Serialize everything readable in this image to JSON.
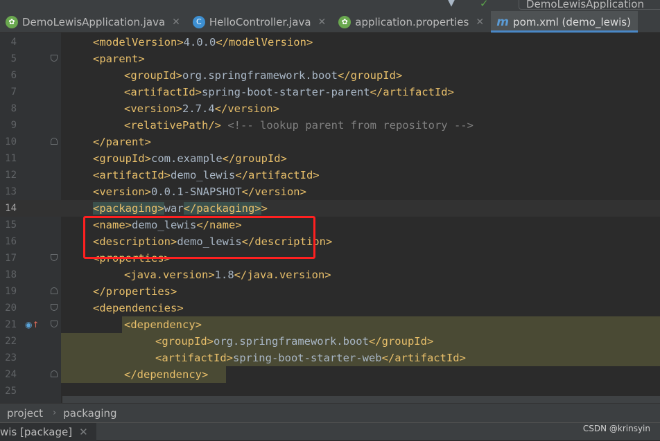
{
  "top": {
    "run_config_label": "DemoLewisApplication"
  },
  "tabs": [
    {
      "label": "DemoLewisApplication.java",
      "icon": "spring-icon",
      "active": false
    },
    {
      "label": "HelloController.java",
      "icon": "class-icon",
      "active": false
    },
    {
      "label": "application.properties",
      "icon": "spring-icon",
      "active": false
    },
    {
      "label": "pom.xml (demo_lewis)",
      "icon": "maven-icon",
      "active": true
    }
  ],
  "editor": {
    "lines": [
      {
        "n": "4",
        "indent": 1,
        "parts": [
          [
            "tag",
            "<modelVersion>"
          ],
          [
            "txt",
            "4.0.0"
          ],
          [
            "tag",
            "</modelVersion>"
          ]
        ]
      },
      {
        "n": "5",
        "indent": 1,
        "fold": "open",
        "parts": [
          [
            "tag",
            "<parent>"
          ]
        ]
      },
      {
        "n": "6",
        "indent": 2,
        "parts": [
          [
            "tag",
            "<groupId>"
          ],
          [
            "txt",
            "org.springframework.boot"
          ],
          [
            "tag",
            "</groupId>"
          ]
        ]
      },
      {
        "n": "7",
        "indent": 2,
        "parts": [
          [
            "tag",
            "<artifactId>"
          ],
          [
            "txt",
            "spring-boot-starter-parent"
          ],
          [
            "tag",
            "</artifactId>"
          ]
        ]
      },
      {
        "n": "8",
        "indent": 2,
        "parts": [
          [
            "tag",
            "<version>"
          ],
          [
            "txt",
            "2.7.4"
          ],
          [
            "tag",
            "</version>"
          ]
        ]
      },
      {
        "n": "9",
        "indent": 2,
        "parts": [
          [
            "tag",
            "<relativePath/>"
          ],
          [
            "txt",
            " "
          ],
          [
            "cmt",
            "<!-- lookup parent from repository -->"
          ]
        ]
      },
      {
        "n": "10",
        "indent": 1,
        "fold": "close",
        "parts": [
          [
            "tag",
            "</parent>"
          ]
        ]
      },
      {
        "n": "11",
        "indent": 1,
        "parts": [
          [
            "tag",
            "<groupId>"
          ],
          [
            "txt",
            "com.example"
          ],
          [
            "tag",
            "</groupId>"
          ]
        ]
      },
      {
        "n": "12",
        "indent": 1,
        "parts": [
          [
            "tag",
            "<artifactId>"
          ],
          [
            "txt",
            "demo_lewis"
          ],
          [
            "tag",
            "</artifactId>"
          ]
        ]
      },
      {
        "n": "13",
        "indent": 1,
        "parts": [
          [
            "tag",
            "<version>"
          ],
          [
            "txt",
            "0.0.1-SNAPSHOT"
          ],
          [
            "tag",
            "</version>"
          ]
        ]
      },
      {
        "n": "14",
        "indent": 1,
        "current": true,
        "parts": [
          [
            "tagpair",
            "<packaging>"
          ],
          [
            "txt",
            "war"
          ],
          [
            "tagpair",
            "</packaging>"
          ],
          [
            "tag",
            ">"
          ]
        ]
      },
      {
        "n": "15",
        "indent": 1,
        "parts": [
          [
            "tag",
            "<name>"
          ],
          [
            "txt",
            "demo_lewis"
          ],
          [
            "tag",
            "</name>"
          ]
        ]
      },
      {
        "n": "16",
        "indent": 1,
        "parts": [
          [
            "tag",
            "<description>"
          ],
          [
            "txt",
            "demo_lewis"
          ],
          [
            "tag",
            "</description>"
          ]
        ]
      },
      {
        "n": "17",
        "indent": 1,
        "fold": "open",
        "parts": [
          [
            "tag",
            "<properties>"
          ]
        ]
      },
      {
        "n": "18",
        "indent": 2,
        "parts": [
          [
            "tag",
            "<java.version>"
          ],
          [
            "txt",
            "1.8"
          ],
          [
            "tag",
            "</java.version>"
          ]
        ]
      },
      {
        "n": "19",
        "indent": 1,
        "fold": "close",
        "parts": [
          [
            "tag",
            "</properties>"
          ]
        ]
      },
      {
        "n": "20",
        "indent": 1,
        "fold": "open",
        "parts": [
          [
            "tag",
            "<dependencies>"
          ]
        ]
      },
      {
        "n": "21",
        "indent": 2,
        "fold": "open",
        "marker": true,
        "parts": [
          [
            "tag",
            "<dependency>"
          ]
        ]
      },
      {
        "n": "22",
        "indent": 3,
        "parts": [
          [
            "tag",
            "<groupId>"
          ],
          [
            "txt",
            "org.springframework.boot"
          ],
          [
            "tag",
            "</groupId>"
          ]
        ]
      },
      {
        "n": "23",
        "indent": 3,
        "parts": [
          [
            "tag",
            "<artifactId>"
          ],
          [
            "txt",
            "spring-boot-starter-web"
          ],
          [
            "tag",
            "</artifactId>"
          ]
        ]
      },
      {
        "n": "24",
        "indent": 2,
        "fold": "close",
        "parts": [
          [
            "tag",
            "</dependency>"
          ]
        ]
      },
      {
        "n": "25",
        "indent": 0,
        "parts": []
      }
    ]
  },
  "breadcrumb": [
    "project",
    "packaging"
  ],
  "bottom_tab": {
    "label": "wis [package]"
  },
  "watermark": "CSDN @krinsyin",
  "colors": {
    "tag": "#e8bf6a",
    "text": "#a9b7c6",
    "comment": "#808080",
    "highlight": "#ff2020"
  }
}
